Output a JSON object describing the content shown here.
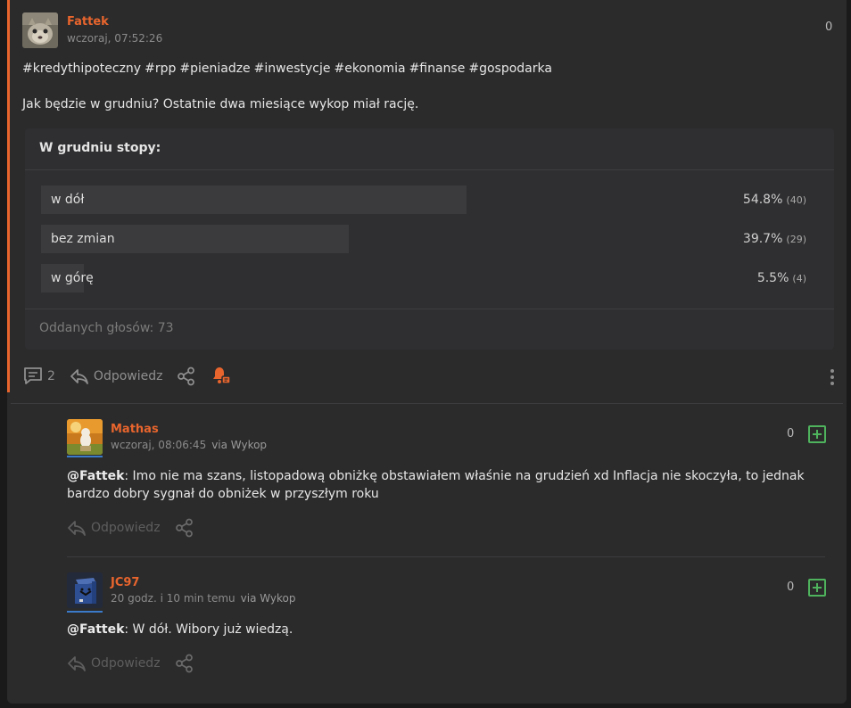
{
  "entry": {
    "author": "Fattek",
    "time": "wczoraj, 07:52:26",
    "votes": "0",
    "tags": [
      "#kredythipoteczny",
      "#rpp",
      "#pieniadze",
      "#inwestycje",
      "#ekonomia",
      "#finanse",
      "#gospodarka"
    ],
    "text": "Jak będzie w grudniu? Ostatnie dwa miesiące wykop miał rację.",
    "poll": {
      "title": "W grudniu stopy:",
      "options": [
        {
          "label": "w dół",
          "percent": "54.8%",
          "count": "(40)",
          "share": 0.548
        },
        {
          "label": "bez zmian",
          "percent": "39.7%",
          "count": "(29)",
          "share": 0.397
        },
        {
          "label": "w górę",
          "percent": "5.5%",
          "count": "(4)",
          "share": 0.055
        }
      ],
      "footer": "Oddanych głosów: 73"
    },
    "comments_count": "2",
    "reply_label": "Odpowiedz"
  },
  "comments": [
    {
      "author": "Mathas",
      "time": "wczoraj, 08:06:45",
      "via": "via Wykop",
      "votes": "0",
      "mention": "@Fattek",
      "text": ": Imo nie ma szans, listopadową obniżkę obstawiałem właśnie na grudzień xd Inflacja nie skoczyła, to jednak bardzo dobry sygnał do obniżek w przyszłym roku",
      "reply_label": "Odpowiedz"
    },
    {
      "author": "JC97",
      "time": "20 godz. i 10 min temu",
      "via": "via Wykop",
      "votes": "0",
      "mention": "@Fattek",
      "text": ": W dół. Wibory już wiedzą.",
      "reply_label": "Odpowiedz"
    }
  ],
  "colors": {
    "accent": "#e8652d",
    "plus": "#4eb35c",
    "avatar_line": "#3a7ac8"
  },
  "icons": [
    "comment-icon",
    "reply-icon",
    "share-icon",
    "notify-bell-icon",
    "more-icon",
    "plus-vote-icon"
  ]
}
